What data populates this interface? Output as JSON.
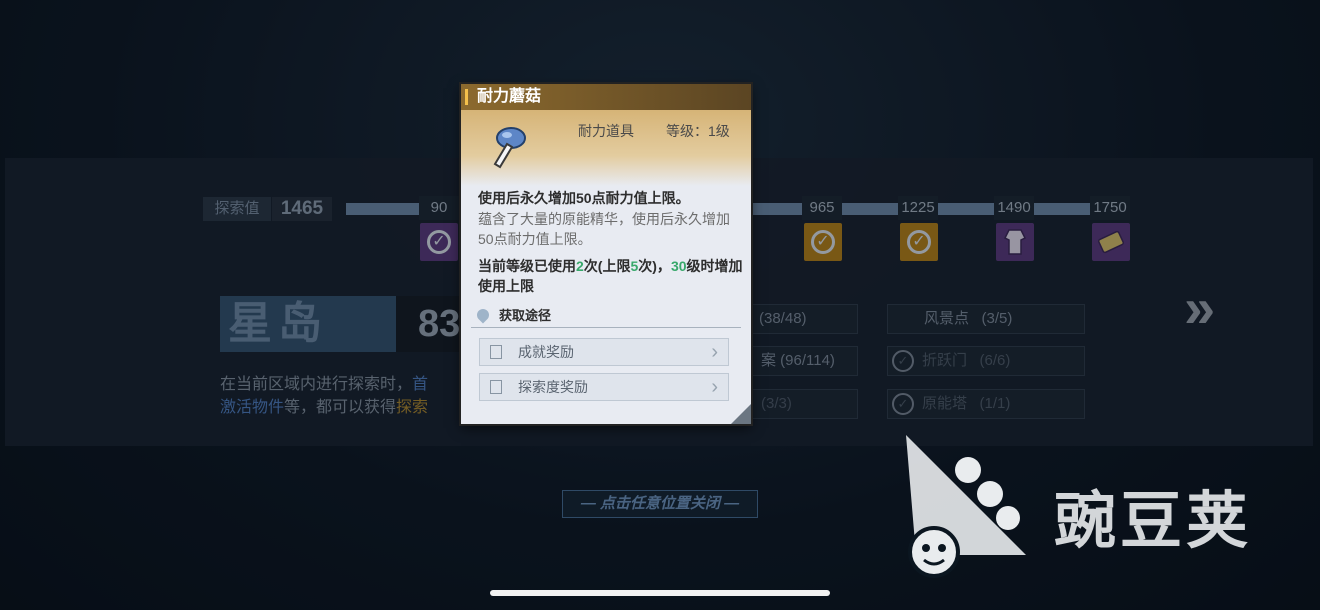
{
  "explore": {
    "label": "探索值",
    "value": "1465",
    "milestones": [
      {
        "value": "90",
        "reward": "check",
        "color": "#5b3b7e"
      },
      {
        "value": "965",
        "reward": "check",
        "color": "#b78318"
      },
      {
        "value": "1225",
        "reward": "check",
        "color": "#b78318"
      },
      {
        "value": "1490",
        "reward": "costume",
        "color": "#5b3b7e"
      },
      {
        "value": "1750",
        "reward": "ticket",
        "color": "#5b3b7e"
      }
    ]
  },
  "region": {
    "name": "星岛",
    "percent_partial": "83",
    "desc_line1_a": "在当前区域内进行探索时，",
    "desc_line1_b": "首",
    "desc_line2_a": "激活物件",
    "desc_line2_b": "等，都可以获得",
    "desc_line2_c": "探索"
  },
  "stats": {
    "left": [
      {
        "text": "(38/48)"
      },
      {
        "text": "案  (96/114)"
      },
      {
        "text": "(3/3)"
      }
    ],
    "right": [
      {
        "label": "风景点",
        "count": "(3/5)"
      },
      {
        "label": "折跃门",
        "count": "(6/6)"
      },
      {
        "label": "原能塔",
        "count": "(1/1)"
      }
    ]
  },
  "close_hint": "— 点击任意位置关闭 —",
  "watermark": "豌豆荚",
  "item": {
    "name": "耐力蘑菇",
    "type": "耐力道具",
    "level": "等级：1级",
    "effect": "使用后永久增加50点耐力值上限。",
    "flavor": "蕴含了大量的原能精华，使用后永久增加50点耐力值上限。",
    "usage_a": "当前等级已使用",
    "usage_used": "2",
    "usage_b": "次(上限",
    "usage_limit": "5",
    "usage_c": "次)，",
    "usage_level": "30",
    "usage_d": "级时增加使用上限",
    "source_title": "获取途径",
    "sources": [
      "成就奖励",
      "探索度奖励"
    ]
  },
  "colors": {
    "accent_gold": "#f4c04b",
    "usage_green": "#38a86b"
  }
}
